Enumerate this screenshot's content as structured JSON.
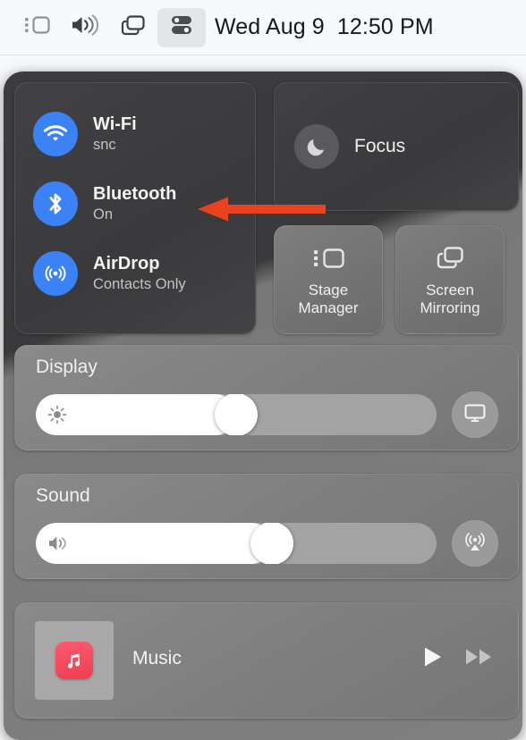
{
  "menubar": {
    "icons": [
      {
        "name": "stage-manager-icon",
        "label": "Stage Manager"
      },
      {
        "name": "volume-icon",
        "label": "Volume"
      },
      {
        "name": "screen-mirroring-icon",
        "label": "Screen Mirroring"
      },
      {
        "name": "control-center-icon",
        "label": "Control Center",
        "active": true
      }
    ],
    "clock": "Wed Aug 9  12:50 PM"
  },
  "control_center": {
    "connectivity": [
      {
        "icon": "wifi-icon",
        "title": "Wi-Fi",
        "status": "snc"
      },
      {
        "icon": "bluetooth-icon",
        "title": "Bluetooth",
        "status": "On"
      },
      {
        "icon": "airdrop-icon",
        "title": "AirDrop",
        "status": "Contacts Only"
      }
    ],
    "focus": {
      "icon": "moon-icon",
      "label": "Focus"
    },
    "tiles": [
      {
        "icon": "stage-manager-icon",
        "label": "Stage\nManager",
        "line1": "Stage",
        "line2": "Manager"
      },
      {
        "icon": "screen-mirroring-icon",
        "label": "Screen\nMirroring",
        "line1": "Screen",
        "line2": "Mirroring"
      }
    ],
    "display": {
      "title": "Display",
      "glyph": "brightness-icon",
      "value_percent": 50,
      "action_icon": "monitor-icon"
    },
    "sound": {
      "title": "Sound",
      "glyph": "speaker-icon",
      "value_percent": 60,
      "action_icon": "airplay-audio-icon"
    },
    "music": {
      "app_icon": "apple-music-icon",
      "title": "Music",
      "play_label": "Play",
      "forward_label": "Fast Forward"
    }
  },
  "annotation": {
    "type": "arrow",
    "points_to": "Bluetooth",
    "color": "#e8421f"
  },
  "colors": {
    "accent_blue": "#3b82f6",
    "panel_gray": "#808080",
    "card_dark": "#3a3a3c",
    "annotation_red": "#e8421f",
    "music_red": "#ef3e52"
  }
}
